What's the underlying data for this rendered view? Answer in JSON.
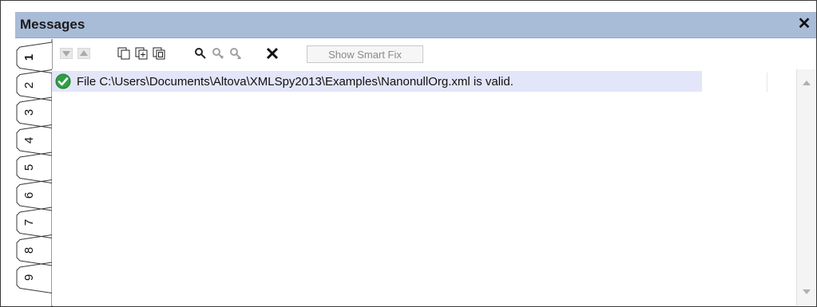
{
  "window": {
    "title": "Messages",
    "close_glyph": "✕"
  },
  "tabs": [
    {
      "label": "1",
      "active": true
    },
    {
      "label": "2",
      "active": false
    },
    {
      "label": "3",
      "active": false
    },
    {
      "label": "4",
      "active": false
    },
    {
      "label": "5",
      "active": false
    },
    {
      "label": "6",
      "active": false
    },
    {
      "label": "7",
      "active": false
    },
    {
      "label": "8",
      "active": false
    },
    {
      "label": "9",
      "active": false
    }
  ],
  "toolbar": {
    "buttons": [
      {
        "name": "next-message-icon",
        "enabled": false
      },
      {
        "name": "previous-message-icon",
        "enabled": false
      },
      {
        "name": "copy-message-icon",
        "enabled": true
      },
      {
        "name": "copy-message-with-children-icon",
        "enabled": true
      },
      {
        "name": "copy-all-messages-icon",
        "enabled": true
      },
      {
        "name": "find-icon",
        "enabled": true
      },
      {
        "name": "find-next-icon",
        "enabled": false
      },
      {
        "name": "find-previous-icon",
        "enabled": false
      },
      {
        "name": "clear-icon",
        "enabled": true
      }
    ],
    "smart_fix_label": "Show Smart Fix"
  },
  "messages": [
    {
      "status": "valid",
      "icon": "check-circle-icon",
      "text": "File C:\\Users\\Documents\\Altova\\XMLSpy2013\\Examples\\NanonullOrg.xml is valid."
    }
  ],
  "colors": {
    "title_bar": "#a8bcd8",
    "message_highlight": "#e3e5f8",
    "valid_green": "#2ea043"
  }
}
